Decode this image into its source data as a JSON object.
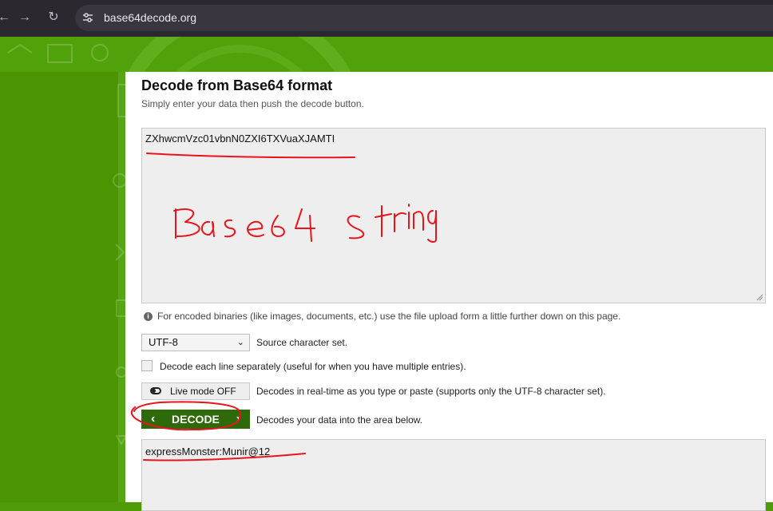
{
  "browser": {
    "url": "base64decode.org",
    "back_icon": "arrow-left-icon",
    "forward_icon": "arrow-right-icon",
    "reload_icon": "reload-icon",
    "site_info_icon": "tune-icon"
  },
  "page": {
    "title": "Decode from Base64 format",
    "subtitle": "Simply enter your data then push the decode button.",
    "input_value": "ZXhwcmVzc01vbnN0ZXI6TXVuaXJAMTI",
    "info_text": "For encoded binaries (like images, documents, etc.) use the file upload form a little further down on this page.",
    "charset": {
      "selected": "UTF-8",
      "label": "Source character set."
    },
    "decode_lines": {
      "label": "Decode each line separately (useful for when you have multiple entries).",
      "checked": false
    },
    "live_mode": {
      "button_label": "Live mode OFF",
      "label": "Decodes in real-time as you type or paste (supports only the UTF-8 character set)."
    },
    "decode": {
      "button_label": "DECODE",
      "label": "Decodes your data into the area below."
    },
    "output_value": "expressMonster:Munir@12"
  },
  "annotation": {
    "handwritten": "Base64 String",
    "color": "#e8141c"
  },
  "colors": {
    "green": "#4f9a07",
    "dark_green": "#2f6a0a",
    "browser": "#2b2830"
  }
}
